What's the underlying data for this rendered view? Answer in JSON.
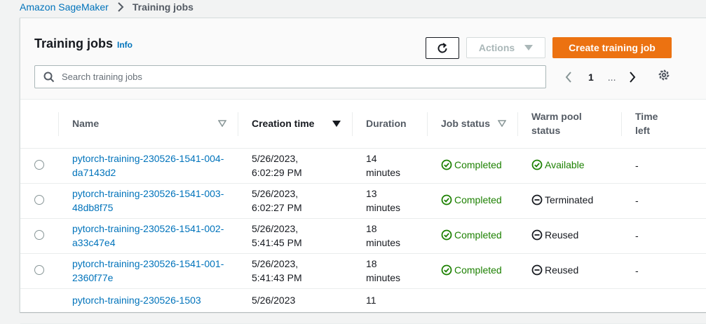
{
  "breadcrumb": {
    "root": "Amazon SageMaker",
    "current": "Training jobs"
  },
  "panel": {
    "title": "Training jobs",
    "info_label": "Info",
    "actions_label": "Actions",
    "create_label": "Create training job",
    "search_placeholder": "Search training jobs",
    "pagination": {
      "current_page": "1",
      "ellipsis": "..."
    }
  },
  "table": {
    "columns": {
      "name": "Name",
      "creation_time": "Creation time",
      "duration": "Duration",
      "job_status": "Job status",
      "warm_pool_status": "Warm pool status",
      "time_left": "Time left"
    },
    "sort": {
      "column": "creation_time",
      "direction": "descending"
    },
    "rows": [
      {
        "name": "pytorch-training-230526-1541-004-da7143d2",
        "creation_time": "5/26/2023, 6:02:29 PM",
        "duration": "14 minutes",
        "job_status": "Completed",
        "warm_pool_status": "Available",
        "warm_pool_icon": "check-circle-icon",
        "time_left": "-"
      },
      {
        "name": "pytorch-training-230526-1541-003-48db8f75",
        "creation_time": "5/26/2023, 6:02:27 PM",
        "duration": "13 minutes",
        "job_status": "Completed",
        "warm_pool_status": "Terminated",
        "warm_pool_icon": "minus-circle-icon",
        "time_left": "-"
      },
      {
        "name": "pytorch-training-230526-1541-002-a33c47e4",
        "creation_time": "5/26/2023, 5:41:45 PM",
        "duration": "18 minutes",
        "job_status": "Completed",
        "warm_pool_status": "Reused",
        "warm_pool_icon": "minus-circle-icon",
        "time_left": "-"
      },
      {
        "name": "pytorch-training-230526-1541-001-2360f77e",
        "creation_time": "5/26/2023, 5:41:43 PM",
        "duration": "18 minutes",
        "job_status": "Completed",
        "warm_pool_status": "Reused",
        "warm_pool_icon": "minus-circle-icon",
        "time_left": "-"
      },
      {
        "name": "pytorch-training-230526-1503",
        "creation_time": "5/26/2023",
        "duration": "11",
        "job_status": "",
        "warm_pool_status": "",
        "warm_pool_icon": "",
        "time_left": ""
      }
    ]
  },
  "colors": {
    "link": "#0073bb",
    "primary_button": "#ec7211",
    "success": "#1d8102",
    "text": "#16191f",
    "secondary_text": "#545b64"
  }
}
